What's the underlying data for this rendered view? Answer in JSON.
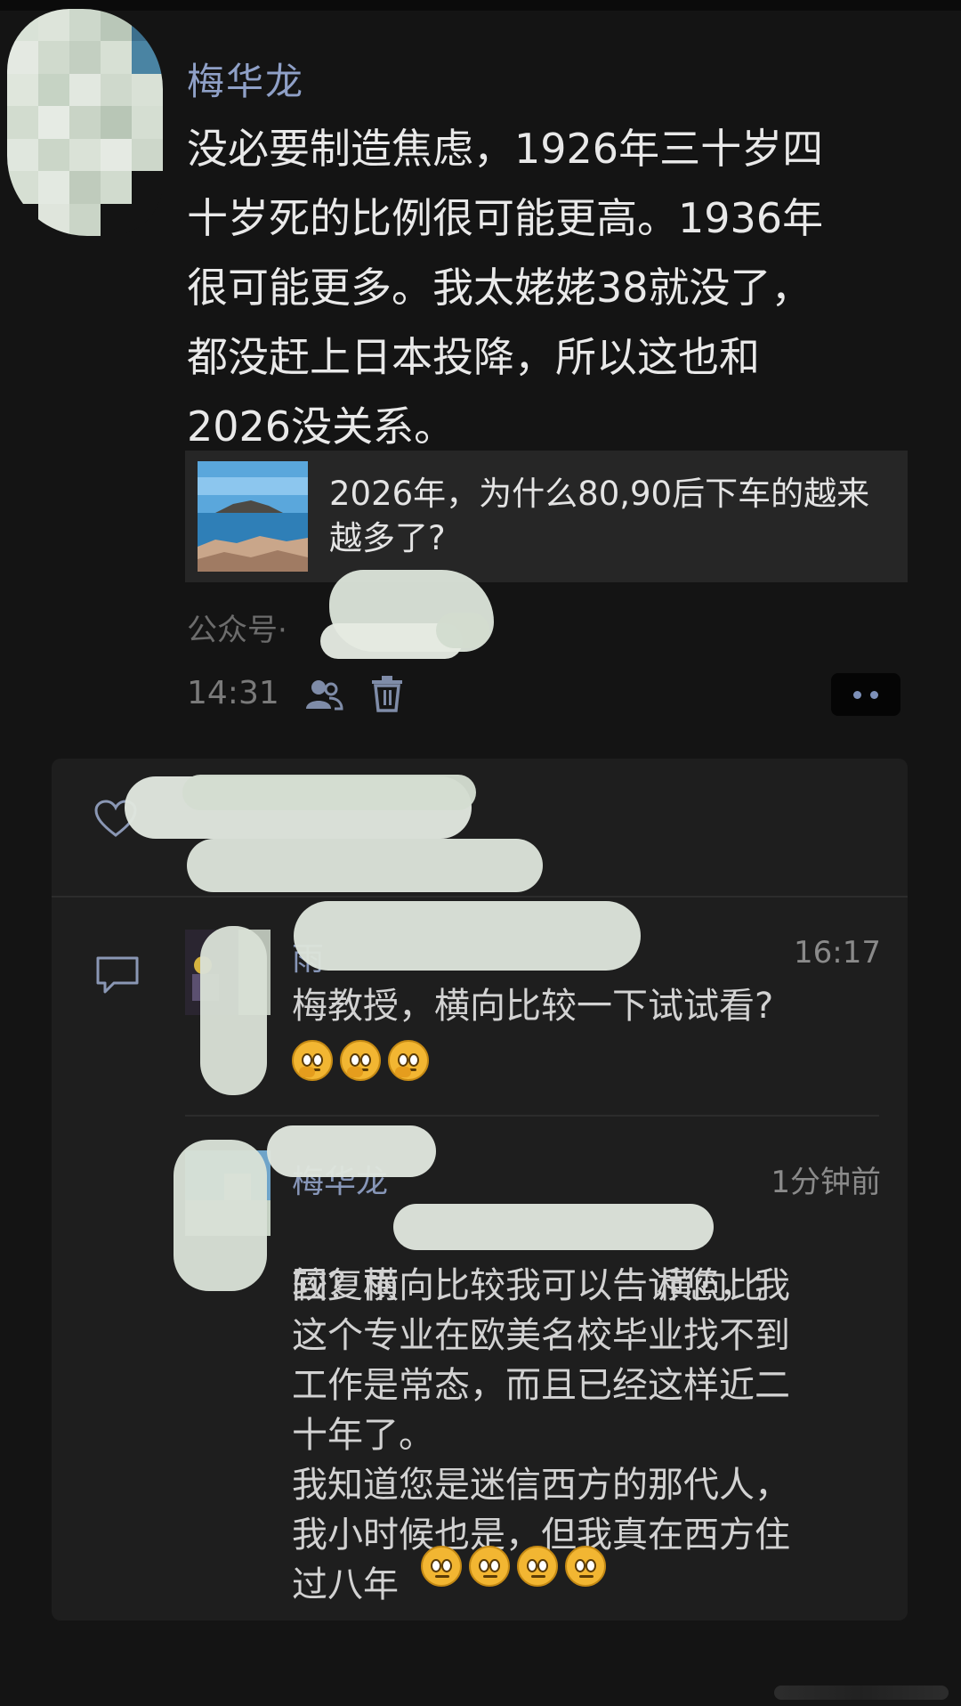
{
  "post": {
    "author": "梅华龙",
    "text": "没必要制造焦虑，1926年三十岁四\n十岁死的比例很可能更高。1936年\n很可能更多。我太姥姥38就没了，\n都没赶上日本投降，所以这也和\n2026没关系。",
    "link_title": "2026年，为什么80,90后下车的越来越多了?",
    "source_label": "公众号·",
    "time": "14:31",
    "icons": {
      "visibility": "people-visibility-icon",
      "delete": "trash-icon",
      "more": "more-dots-icon"
    }
  },
  "interactions": {
    "like_icon": "heart-icon",
    "comment_icon": "comment-icon",
    "comments": [
      {
        "name": "雨",
        "time": "16:17",
        "text": "梅教授，横向比较一下试试看?",
        "emoji_count": 3
      },
      {
        "name": "梅华龙",
        "time": "1分钟前",
        "text_prefix": "回复雨",
        "text_suffix": "横向比",
        "text": "较？横向比较我可以告诉您，我\n这个专业在欧美名校毕业找不到\n工作是常态，而且已经这样近二\n十年了。\n我知道您是迷信西方的那代人，\n我小时候也是，但我真在西方住\n过八年",
        "emoji_count": 4
      }
    ]
  },
  "colors": {
    "background": "#141414",
    "panel": "#1e1e1e",
    "name_link": "#8fa0c7",
    "body_text": "#e9e9e9",
    "muted": "#7a7a7a"
  }
}
